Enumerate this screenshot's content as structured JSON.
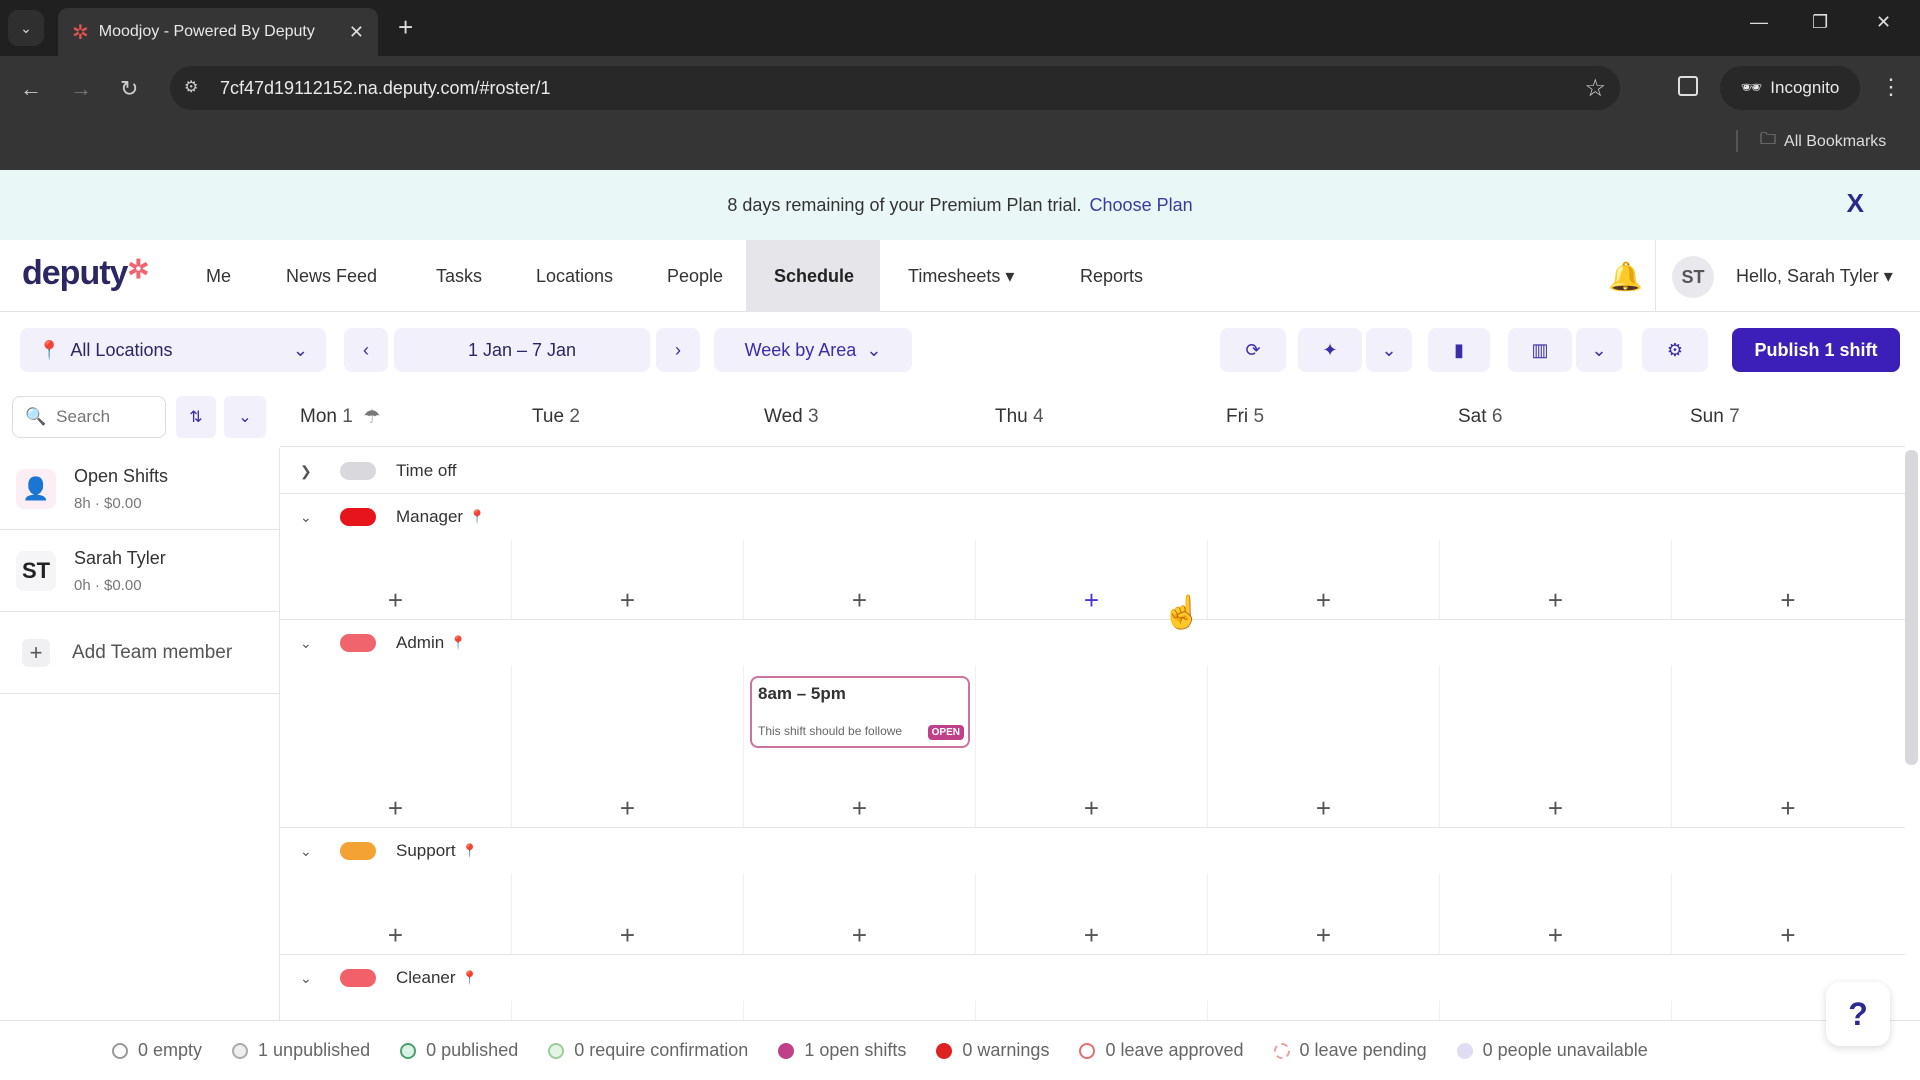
{
  "browser": {
    "tab_title": "Moodjoy - Powered By Deputy",
    "url": "7cf47d19112152.na.deputy.com/#roster/1",
    "incognito_label": "Incognito",
    "bookmarks_label": "All Bookmarks"
  },
  "banner": {
    "message": "8 days remaining of your Premium Plan trial.",
    "link": "Choose Plan",
    "close": "X"
  },
  "nav": {
    "logo": "deputy",
    "items": [
      "Me",
      "News Feed",
      "Tasks",
      "Locations",
      "People",
      "Schedule",
      "Timesheets ▾",
      "Reports"
    ],
    "active": "Schedule",
    "user_initials": "ST",
    "greeting": "Hello, Sarah Tyler ▾"
  },
  "toolbar": {
    "location": "All Locations",
    "date_range": "1 Jan – 7 Jan",
    "view": "Week by Area",
    "publish_label": "Publish 1 shift"
  },
  "search": {
    "placeholder": "Search"
  },
  "days": [
    {
      "name": "Mon",
      "num": "1"
    },
    {
      "name": "Tue",
      "num": "2"
    },
    {
      "name": "Wed",
      "num": "3"
    },
    {
      "name": "Thu",
      "num": "4"
    },
    {
      "name": "Fri",
      "num": "5"
    },
    {
      "name": "Sat",
      "num": "6"
    },
    {
      "name": "Sun",
      "num": "7"
    }
  ],
  "people": [
    {
      "name": "Open Shifts",
      "meta": "8h · $0.00",
      "avatar": "person-icon"
    },
    {
      "name": "Sarah Tyler",
      "meta": "0h · $0.00",
      "avatar": "ST"
    }
  ],
  "add_team_member": "Add Team member",
  "areas": [
    {
      "name": "Time off",
      "color": "#d9d9dd",
      "expanded": false
    },
    {
      "name": "Manager",
      "color": "#e8141c",
      "expanded": true
    },
    {
      "name": "Admin",
      "color": "#f0646e",
      "expanded": true
    },
    {
      "name": "Support",
      "color": "#f4a233",
      "expanded": true
    },
    {
      "name": "Cleaner",
      "color": "#f2606a",
      "expanded": true
    }
  ],
  "shift": {
    "area": "Admin",
    "day": "Wed 3",
    "time": "8am – 5pm",
    "note": "This shift should be followe",
    "badge": "OPEN"
  },
  "legend": [
    {
      "label": "0 empty",
      "color": "#ffffff",
      "border": "#999"
    },
    {
      "label": "1 unpublished",
      "color": "#eeeeee",
      "border": "#aaa"
    },
    {
      "label": "0 published",
      "color": "#d8f2e4",
      "border": "#4aa070"
    },
    {
      "label": "0 require confirmation",
      "color": "#e4f4e4",
      "border": "#9ccc9c"
    },
    {
      "label": "1 open shifts",
      "color": "#c0408a",
      "border": "#c0408a"
    },
    {
      "label": "0 warnings",
      "color": "#dd2222",
      "border": "#dd2222"
    },
    {
      "label": "0 leave approved",
      "color": "#ffffff",
      "border": "#e07070"
    },
    {
      "label": "0 leave pending",
      "color": "#ffffff",
      "border": "#e8a0a0"
    },
    {
      "label": "0 people unavailable",
      "color": "#e0dcf4",
      "border": "#e0dcf4"
    }
  ],
  "help_label": "?"
}
